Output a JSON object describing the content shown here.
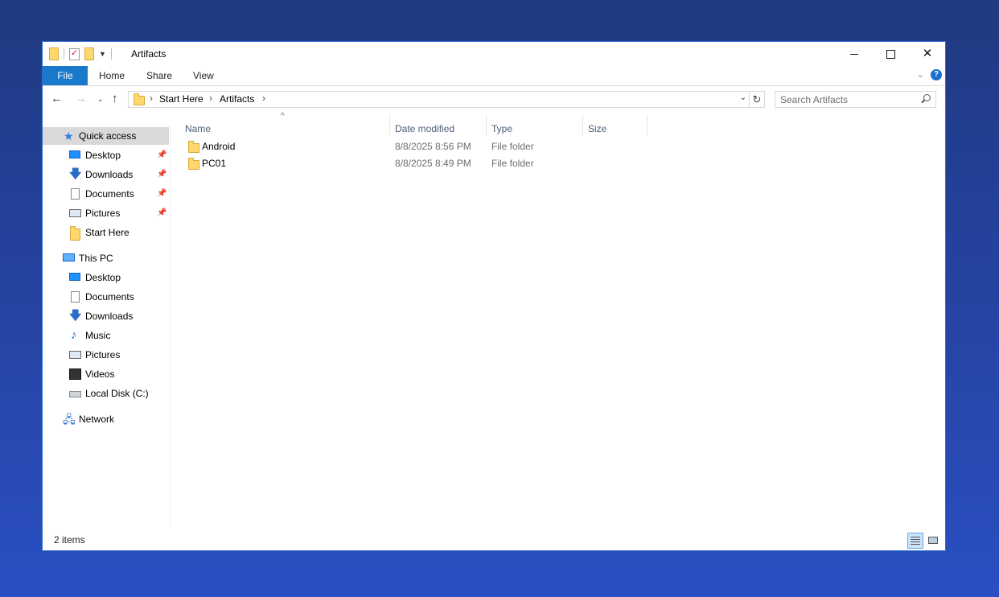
{
  "window": {
    "title": "Artifacts",
    "controls": {
      "minimize": "minimize",
      "maximize": "maximize",
      "close": "✕"
    }
  },
  "ribbon": {
    "tabs": [
      {
        "label": "File",
        "active": true
      },
      {
        "label": "Home"
      },
      {
        "label": "Share"
      },
      {
        "label": "View"
      }
    ],
    "help": "?"
  },
  "navigation": {
    "breadcrumb": [
      "Start Here",
      "Artifacts"
    ],
    "search_placeholder": "Search Artifacts"
  },
  "nav_pane": {
    "quick_access": {
      "label": "Quick access",
      "items": [
        {
          "label": "Desktop",
          "icon": "desktop-icon",
          "pinned": true
        },
        {
          "label": "Downloads",
          "icon": "download-icon",
          "pinned": true
        },
        {
          "label": "Documents",
          "icon": "document-icon",
          "pinned": true
        },
        {
          "label": "Pictures",
          "icon": "pictures-icon",
          "pinned": true
        },
        {
          "label": "Start Here",
          "icon": "folder-icon",
          "pinned": false
        }
      ]
    },
    "this_pc": {
      "label": "This PC",
      "items": [
        {
          "label": "Desktop",
          "icon": "desktop-icon"
        },
        {
          "label": "Documents",
          "icon": "document-icon"
        },
        {
          "label": "Downloads",
          "icon": "download-icon"
        },
        {
          "label": "Music",
          "icon": "music-icon"
        },
        {
          "label": "Pictures",
          "icon": "pictures-icon"
        },
        {
          "label": "Videos",
          "icon": "videos-icon"
        },
        {
          "label": "Local Disk (C:)",
          "icon": "disk-icon"
        }
      ]
    },
    "network": {
      "label": "Network"
    }
  },
  "file_list": {
    "columns": [
      "Name",
      "Date modified",
      "Type",
      "Size"
    ],
    "rows": [
      {
        "name": "Android",
        "date": "8/8/2025 8:56 PM",
        "type": "File folder",
        "size": ""
      },
      {
        "name": "PC01",
        "date": "8/8/2025 8:49 PM",
        "type": "File folder",
        "size": ""
      }
    ]
  },
  "status_bar": {
    "item_count": "2 items"
  },
  "colors": {
    "accent": "#1979ca",
    "selection": "#d9d9d9",
    "desktop_bg": "#2a4fc2"
  }
}
